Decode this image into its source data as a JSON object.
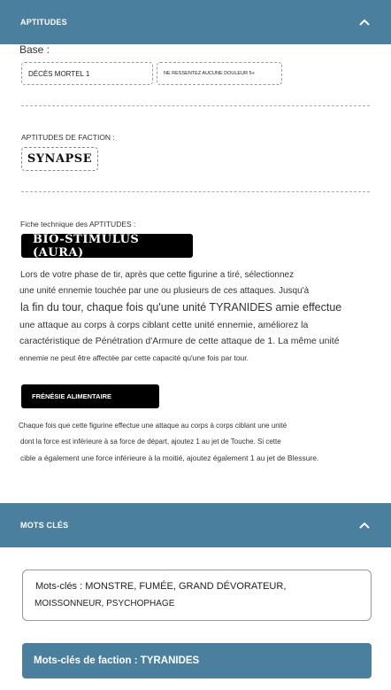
{
  "aptitudes_section": {
    "header": "APTITUDES",
    "base_label": "Base :",
    "base_items": [
      "DÉCÈS MORTEL 1",
      "NE RESSENTEZ AUCUNE DOULEUR 5+"
    ],
    "faction_label": "APTITUDES DE FACTION :",
    "faction_tag": "SYNAPSE",
    "datasheet_label": "Fiche technique des APTITUDES :",
    "ability1": {
      "name": "BIO-STIMULUS (AURA)",
      "lines": [
        "Lors de votre phase de tir, après que cette figurine a tiré, sélectionnez",
        "une unité ennemie touchée par une ou plusieurs de ces attaques. Jusqu'à",
        "la fin du tour, chaque fois qu'une unité TYRANIDES amie effectue",
        "une attaque au corps à corps ciblant cette unité ennemie, améliorez la",
        "caractéristique de Pénétration d'Armure de cette attaque de 1. La même unité",
        "ennemie ne peut être affectée par cette capacité qu'une fois par tour."
      ]
    },
    "ability2": {
      "name": "FRÉNÉSIE ALIMENTAIRE",
      "lines": [
        "Chaque fois que cette figurine effectue une attaque au corps à corps ciblant une unité",
        "dont la force est inférieure à sa force de départ, ajoutez 1 au jet de Touche. Si cette",
        "cible a également une force inférieure à la moitié, ajoutez également 1 au jet de Blessure."
      ]
    }
  },
  "keywords_section": {
    "header": "MOTS CLÉS",
    "keywords_line1": "Mots-clés : MONSTRE, FUMÉE, GRAND DÉVORATEUR,",
    "keywords_line2": "MOISSONNEUR, PSYCHOPHAGE",
    "faction_keywords": "Mots-clés de faction : TYRANIDES"
  },
  "colors": {
    "header_bg": "#4a7f9d",
    "tag_black": "#000000"
  },
  "icons": {
    "collapse": "chevron-up-icon"
  }
}
